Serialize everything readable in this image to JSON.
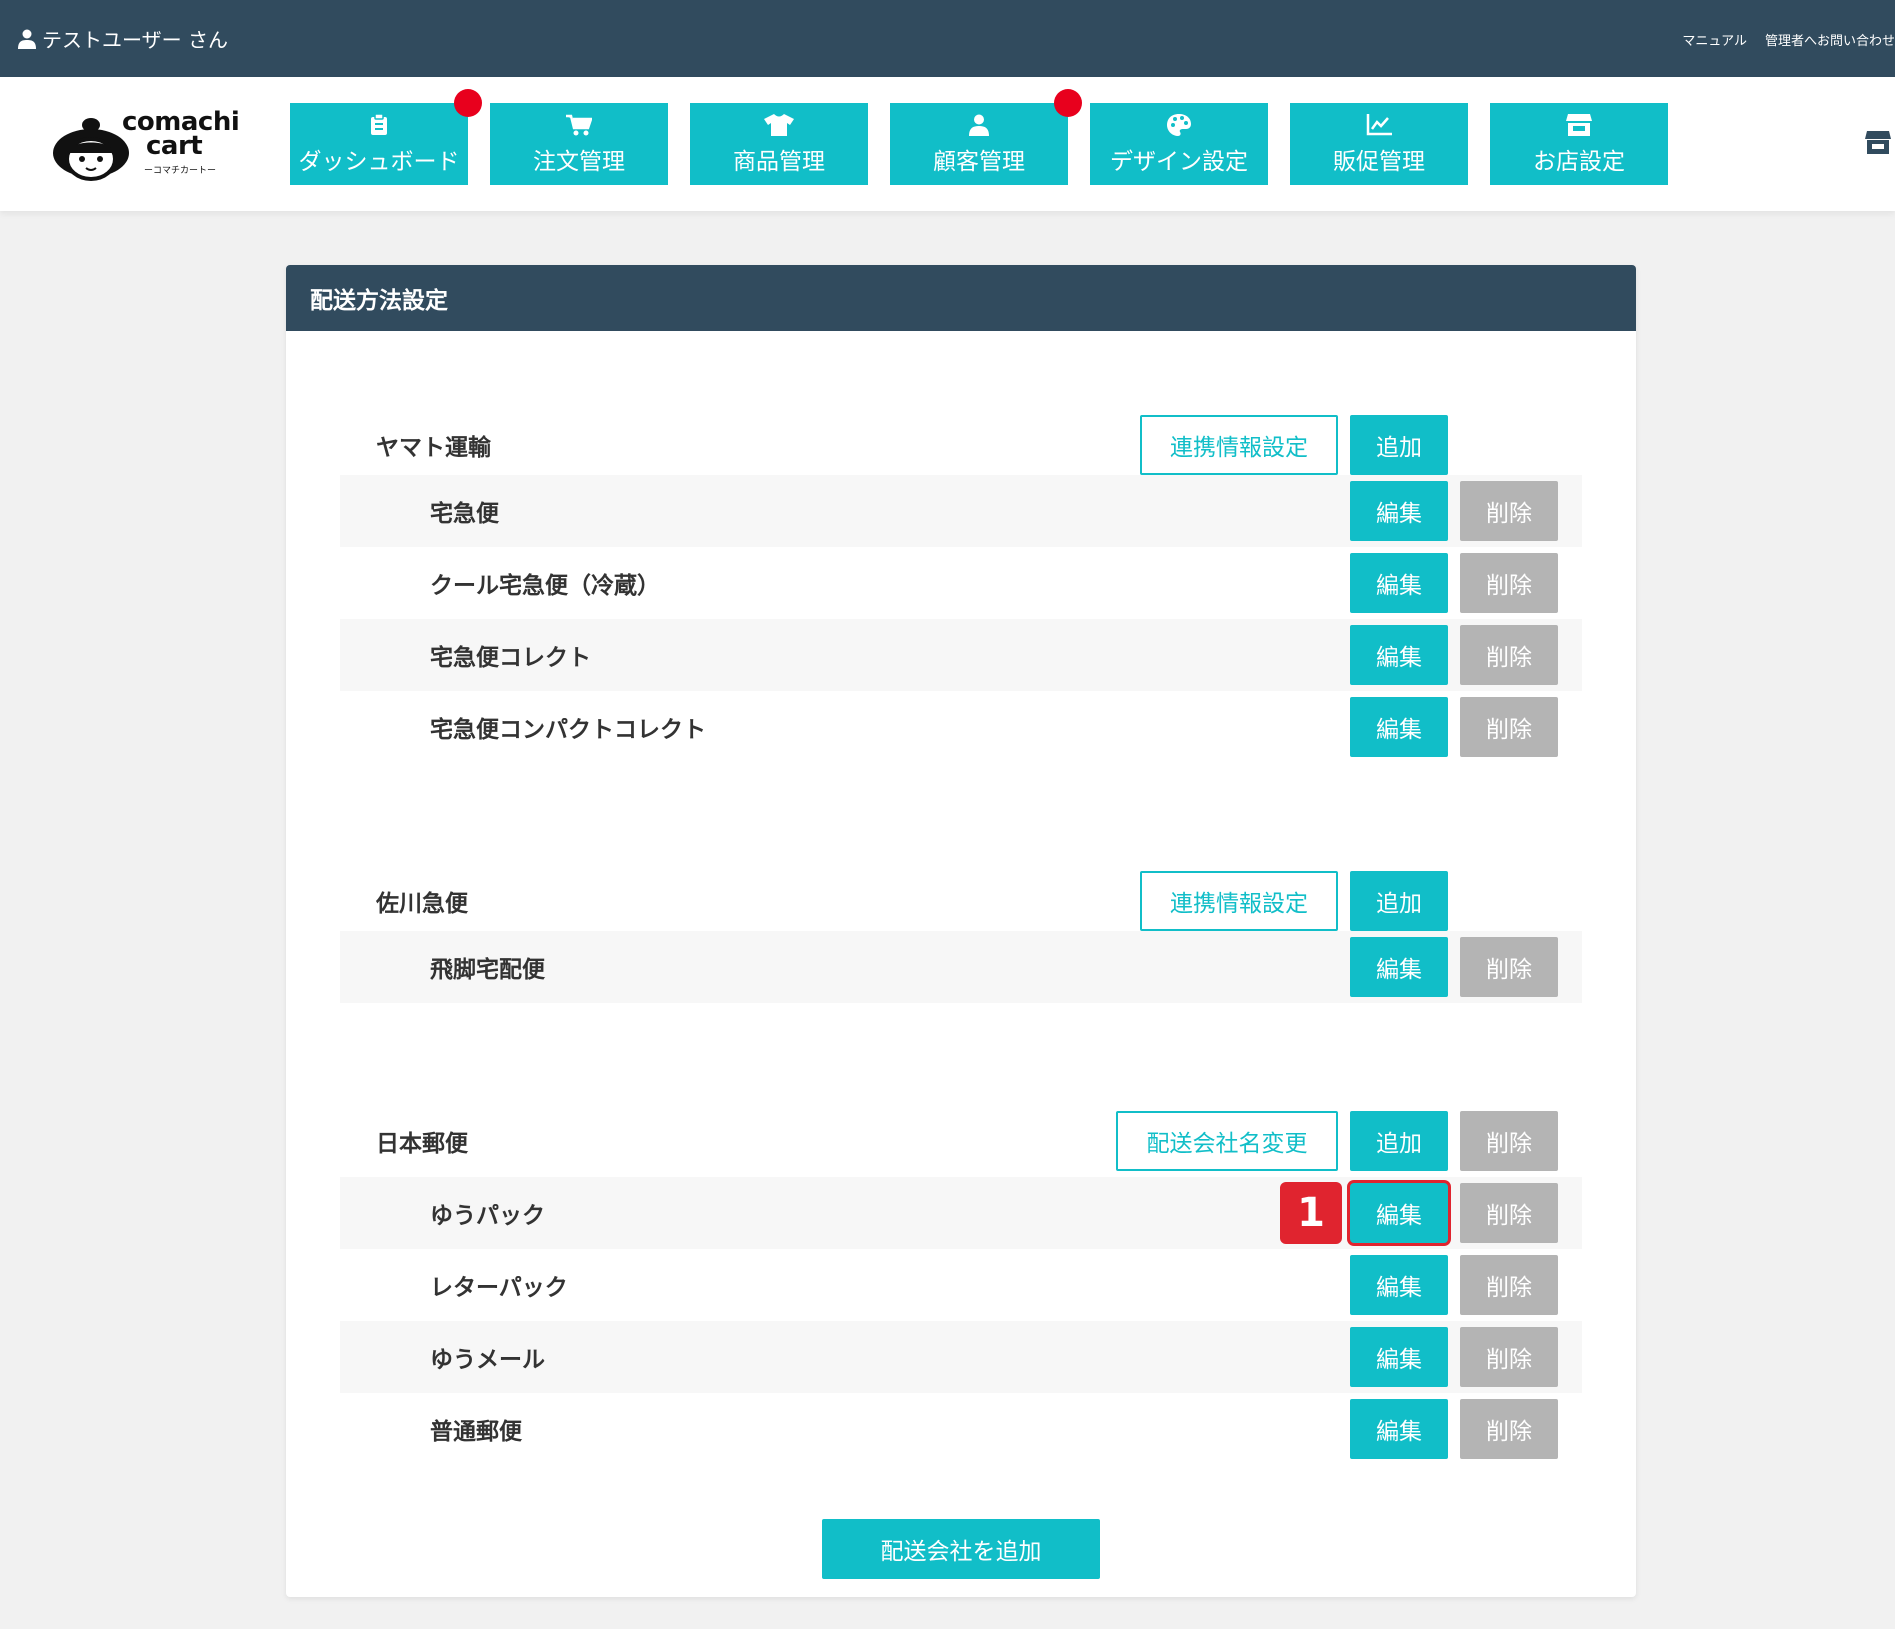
{
  "topbar": {
    "user_name": "テストユーザー さん",
    "manual_link": "マニュアル",
    "contact_link": "管理者へお問い合わせ"
  },
  "logo": {
    "brand_line1": "comachi",
    "brand_line2": "cart",
    "brand_sub": "ーコマチカートー"
  },
  "nav": {
    "items": [
      {
        "label": "ダッシュボード",
        "icon": "clipboard-icon",
        "badge": true
      },
      {
        "label": "注文管理",
        "icon": "cart-icon",
        "badge": false
      },
      {
        "label": "商品管理",
        "icon": "tshirt-icon",
        "badge": false
      },
      {
        "label": "顧客管理",
        "icon": "user-icon",
        "badge": true
      },
      {
        "label": "デザイン設定",
        "icon": "palette-icon",
        "badge": false
      },
      {
        "label": "販促管理",
        "icon": "chart-line-icon",
        "badge": false
      },
      {
        "label": "お店設定",
        "icon": "store-icon",
        "badge": false
      }
    ]
  },
  "card": {
    "title": "配送方法設定"
  },
  "labels": {
    "link_settings": "連携情報設定",
    "rename_company": "配送会社名変更",
    "add": "追加",
    "edit": "編集",
    "delete": "削除",
    "add_company": "配送会社を追加",
    "step_marker": "1"
  },
  "companies": [
    {
      "name": "ヤマト運輸",
      "services": [
        "宅急便",
        "クール宅急便（冷蔵）",
        "宅急便コレクト",
        "宅急便コンパクトコレクト"
      ]
    },
    {
      "name": "佐川急便",
      "services": [
        "飛脚宅配便"
      ]
    },
    {
      "name": "日本郵便",
      "services": [
        "ゆうパック",
        "レターパック",
        "ゆうメール",
        "普通郵便"
      ]
    }
  ],
  "colors": {
    "topbar": "#314b5e",
    "accent": "#11bec8",
    "delete_gray": "#b4b4b4",
    "badge_red": "#e8001d",
    "highlight_red": "#e0242f"
  }
}
